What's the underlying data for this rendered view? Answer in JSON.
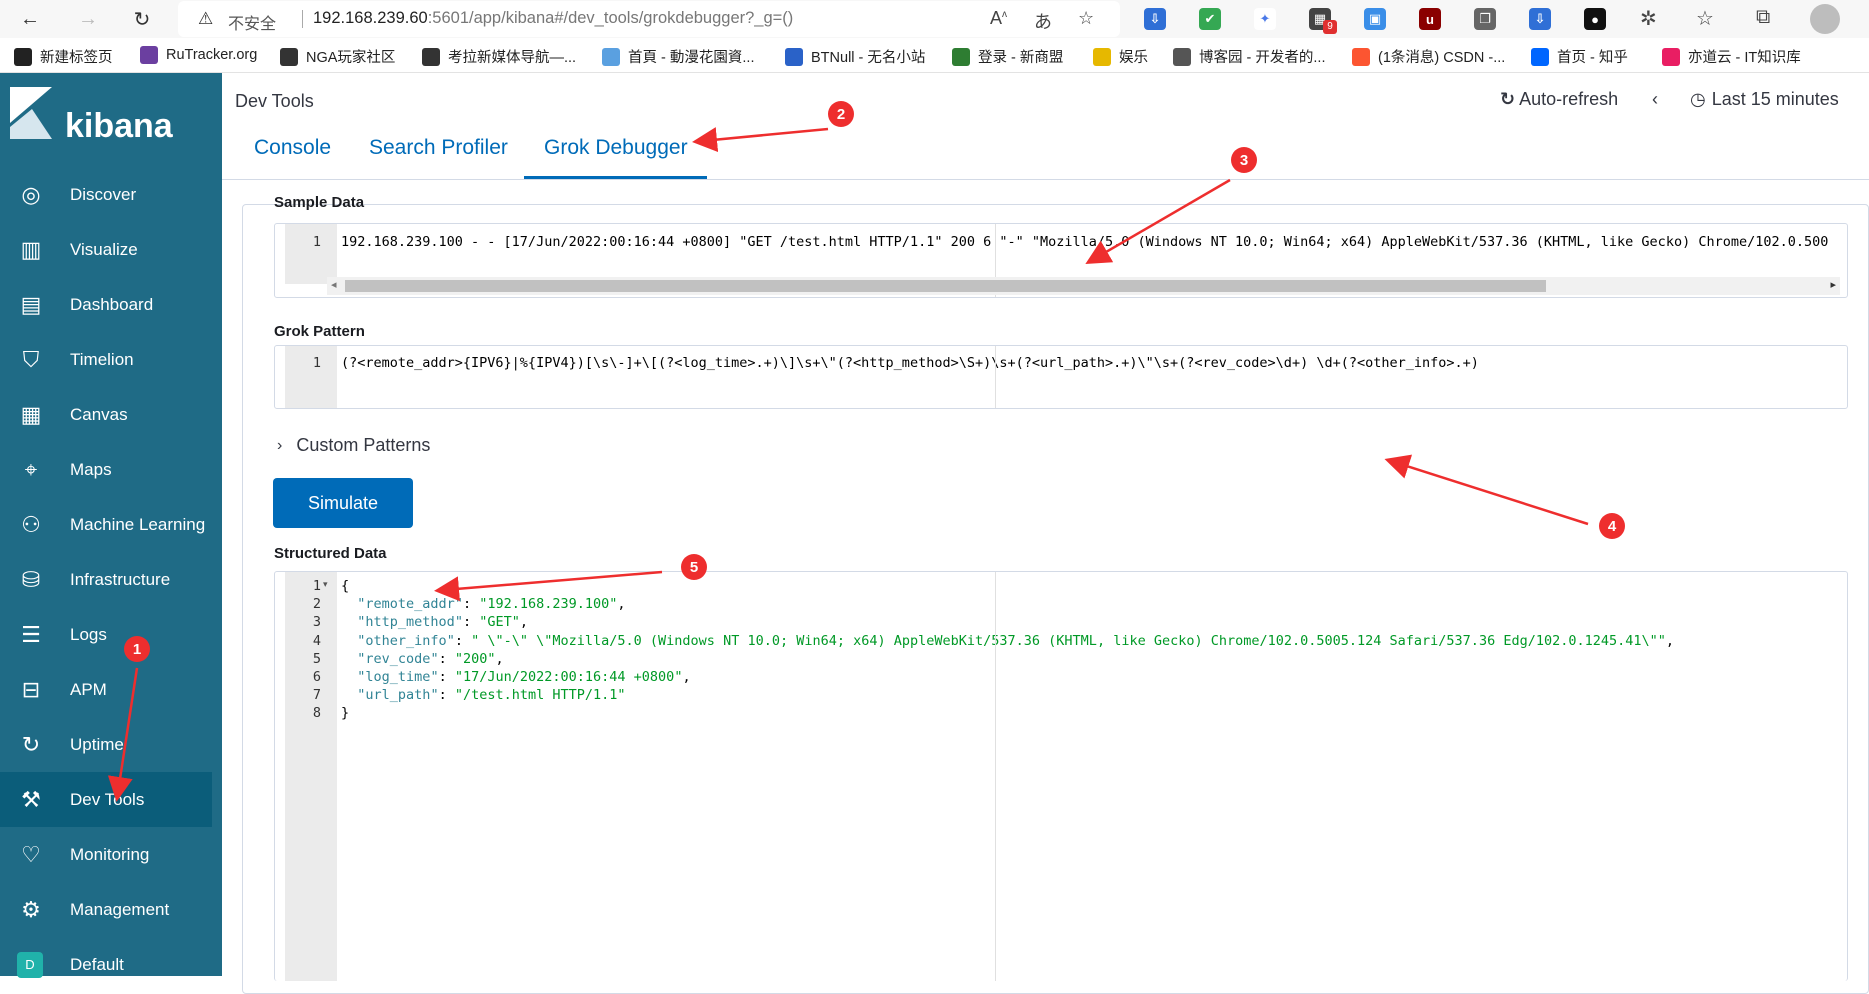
{
  "browser": {
    "insecure_label": "不安全",
    "url_host": "192.168.239.60",
    "url_rest": ":5601/app/kibana#/dev_tools/grokdebugger?_g=()"
  },
  "bookmarks": [
    {
      "label": "新建标签页",
      "color": "#222222"
    },
    {
      "label": "RuTracker.org",
      "color": "#6b3fa0"
    },
    {
      "label": "NGA玩家社区",
      "color": "#333333"
    },
    {
      "label": "考拉新媒体导航—...",
      "color": "#333333"
    },
    {
      "label": "首頁 - 動漫花園資...",
      "color": "#5aa0e0"
    },
    {
      "label": "BTNull - 无名小站",
      "color": "#2a62c8"
    },
    {
      "label": "登录 - 新商盟",
      "color": "#2e7d32"
    },
    {
      "label": "娱乐",
      "color": "#e6b800"
    },
    {
      "label": "博客园 - 开发者的...",
      "color": "#555555"
    },
    {
      "label": "(1条消息) CSDN -...",
      "color": "#fc5531"
    },
    {
      "label": "首页 - 知乎",
      "color": "#0066ff"
    },
    {
      "label": "亦道云 - IT知识库",
      "color": "#e91e63"
    }
  ],
  "kibana": {
    "logo_text": "kibana",
    "nav": [
      {
        "label": "Discover",
        "icon": "compass-icon"
      },
      {
        "label": "Visualize",
        "icon": "visualize-icon"
      },
      {
        "label": "Dashboard",
        "icon": "dashboard-icon"
      },
      {
        "label": "Timelion",
        "icon": "timelion-icon"
      },
      {
        "label": "Canvas",
        "icon": "canvas-icon"
      },
      {
        "label": "Maps",
        "icon": "maps-icon"
      },
      {
        "label": "Machine Learning",
        "icon": "ml-icon"
      },
      {
        "label": "Infrastructure",
        "icon": "infrastructure-icon"
      },
      {
        "label": "Logs",
        "icon": "logs-icon"
      },
      {
        "label": "APM",
        "icon": "apm-icon"
      },
      {
        "label": "Uptime",
        "icon": "uptime-icon"
      },
      {
        "label": "Dev Tools",
        "icon": "wrench-icon"
      },
      {
        "label": "Monitoring",
        "icon": "heartbeat-icon"
      },
      {
        "label": "Management",
        "icon": "gear-icon"
      },
      {
        "label": "Default",
        "icon": "space-avatar-icon"
      }
    ],
    "space_avatar": "D"
  },
  "header": {
    "title": "Dev Tools",
    "auto_refresh": "Auto-refresh",
    "time_range": "Last 15 minutes"
  },
  "tabs": [
    "Console",
    "Search Profiler",
    "Grok Debugger"
  ],
  "grok": {
    "sample_title": "Sample Data",
    "sample_line": "192.168.239.100 - - [17/Jun/2022:00:16:44 +0800] \"GET /test.html HTTP/1.1\" 200 6 \"-\" \"Mozilla/5.0 (Windows NT 10.0; Win64; x64) AppleWebKit/537.36 (KHTML, like Gecko) Chrome/102.0.500",
    "pattern_title": "Grok Pattern",
    "pattern_line": "(?<remote_addr>{IPV6}|%{IPV4})[\\s\\-]+\\[(?<log_time>.+)\\]\\s+\\\"(?<http_method>\\S+)\\s+(?<url_path>.+)\\\"\\s+(?<rev_code>\\d+) \\d+(?<other_info>.+)",
    "custom_patterns": "Custom Patterns",
    "simulate": "Simulate",
    "structured_title": "Structured Data",
    "result": [
      {
        "key": "remote_addr",
        "value": "192.168.239.100"
      },
      {
        "key": "http_method",
        "value": "GET"
      },
      {
        "key": "other_info",
        "value": " \\\"-\\\" \\\"Mozilla/5.0 (Windows NT 10.0; Win64; x64) AppleWebKit/537.36 (KHTML, like Gecko) Chrome/102.0.5005.124 Safari/537.36 Edg/102.0.1245.41\\\""
      },
      {
        "key": "rev_code",
        "value": "200"
      },
      {
        "key": "log_time",
        "value": "17/Jun/2022:00:16:44 +0800"
      },
      {
        "key": "url_path",
        "value": "/test.html HTTP/1.1"
      }
    ],
    "line_numbers": [
      "1",
      "2",
      "3",
      "4",
      "5",
      "6",
      "7",
      "8"
    ]
  },
  "annotations": [
    "1",
    "2",
    "3",
    "4",
    "5"
  ],
  "colors": {
    "sidebar": "#1f6b86",
    "accent": "#006bb8",
    "annotation": "#ee2e2e"
  }
}
